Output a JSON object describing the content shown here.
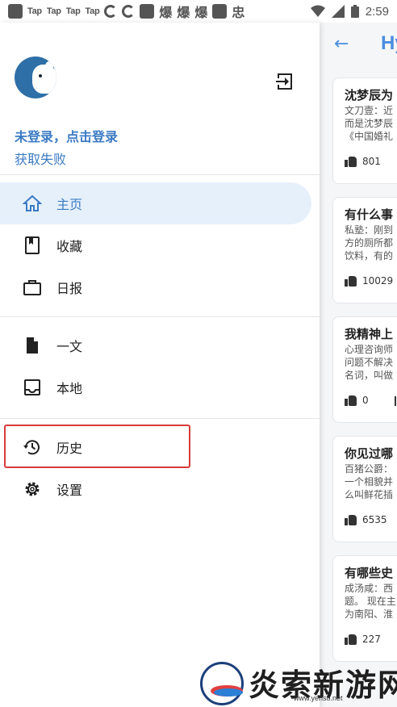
{
  "status_bar": {
    "tap_labels": [
      "Tap",
      "Tap",
      "Tap",
      "Tap"
    ],
    "cn_labels": [
      "爆",
      "爆",
      "爆",
      "忠"
    ],
    "time": "2:59"
  },
  "background": {
    "title": "Hy",
    "cards": [
      {
        "title": "沈梦辰为",
        "lines": [
          "文刀壹：近",
          "而是沈梦辰",
          "《中国婚礼"
        ],
        "likes": "801"
      },
      {
        "title": "有什么事",
        "lines": [
          "私塾：刚到",
          "方的厕所都",
          "饮料，有的"
        ],
        "likes": "10029"
      },
      {
        "title": "我精神上",
        "lines": [
          "心理咨询师",
          "问题不解决",
          "名词，叫做"
        ],
        "likes": "0"
      },
      {
        "title": "你见过哪",
        "lines": [
          "百猪公爵：",
          "一个相貌并",
          "么叫鲜花插"
        ],
        "likes": "6535"
      },
      {
        "title": "有哪些史",
        "lines": [
          "成汤咸：西",
          "题。 现在主",
          "为南阳、淮"
        ],
        "likes": "227"
      }
    ]
  },
  "drawer": {
    "login_title": "未登录，点击登录",
    "login_status": "获取失败",
    "nav": [
      {
        "label": "主页",
        "icon": "home-icon",
        "active": true
      },
      {
        "label": "收藏",
        "icon": "bookmark-icon",
        "active": false
      },
      {
        "label": "日报",
        "icon": "briefcase-icon",
        "active": false
      },
      {
        "label": "一文",
        "icon": "document-icon",
        "active": false
      },
      {
        "label": "本地",
        "icon": "inbox-icon",
        "active": false
      },
      {
        "label": "历史",
        "icon": "history-icon",
        "active": false
      },
      {
        "label": "设置",
        "icon": "gear-icon",
        "active": false
      }
    ]
  },
  "watermark": {
    "text": "炎索新游网",
    "url": "www.yenso.net"
  },
  "colors": {
    "accent": "#3b7bc4",
    "active_bg": "#e6f0fb",
    "highlight": "#d93a3a"
  }
}
